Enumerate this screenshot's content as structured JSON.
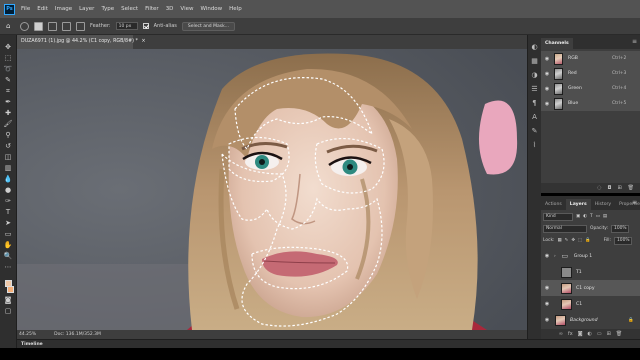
{
  "menubar": {
    "app_logo": "Ps",
    "items": [
      "File",
      "Edit",
      "Image",
      "Layer",
      "Type",
      "Select",
      "Filter",
      "3D",
      "View",
      "Window",
      "Help"
    ]
  },
  "optionsbar": {
    "feather_label": "Feather:",
    "feather_value": "10 px",
    "antialias_label": "Anti-alias",
    "select_mask_label": "Select and Mask..."
  },
  "document": {
    "tab_title": "DUZA6971 (1).jpg @ 44.2% (C1 copy, RGB/8#) *",
    "close_glyph": "×"
  },
  "statusbar": {
    "zoom": "44.25%",
    "doc_info": "Doc: 136.1M/352.3M"
  },
  "timeline": {
    "label": "Timeline"
  },
  "channels_panel": {
    "tabs": [
      "Channels"
    ],
    "rows": [
      {
        "name": "RGB",
        "shortcut": "Ctrl+2"
      },
      {
        "name": "Red",
        "shortcut": "Ctrl+3"
      },
      {
        "name": "Green",
        "shortcut": "Ctrl+4"
      },
      {
        "name": "Blue",
        "shortcut": "Ctrl+5"
      }
    ]
  },
  "layers_panel": {
    "tabs": [
      "Actions",
      "Layers",
      "History",
      "Properties"
    ],
    "filter_value": "Kind",
    "blend_mode": "Normal",
    "opacity_label": "Opacity:",
    "opacity_value": "100%",
    "lock_label": "Lock:",
    "fill_label": "Fill:",
    "fill_value": "100%",
    "layers": [
      {
        "name": "Group 1"
      },
      {
        "name": "T1"
      },
      {
        "name": "C1 copy"
      },
      {
        "name": "C1"
      },
      {
        "name": "Background"
      }
    ]
  },
  "colors": {
    "foreground": "#f0c9a8",
    "background": "#f5b07a",
    "selection": "#ffffff"
  }
}
